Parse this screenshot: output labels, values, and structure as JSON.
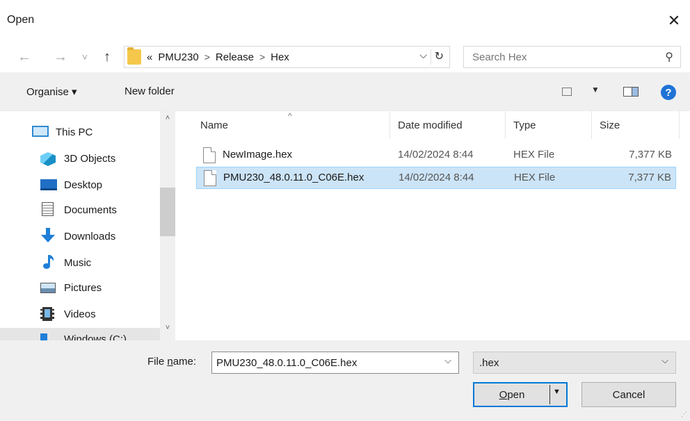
{
  "window": {
    "title": "Open",
    "close_glyph": "✕"
  },
  "nav": {
    "back_icon": "←",
    "forward_icon": "→",
    "recent_icon": "˅",
    "up_icon": "↑"
  },
  "address": {
    "overflow": "«",
    "crumbs": [
      "PMU230",
      "Release",
      "Hex"
    ],
    "separator": ">",
    "dropdown_glyph": "⌵",
    "refresh_glyph": "↻"
  },
  "search": {
    "placeholder": "Search Hex",
    "icon": "⚲"
  },
  "toolbar": {
    "organise_label": "Organise ▾",
    "new_folder_label": "New folder",
    "view_dropdown": "▼",
    "help_label": "?"
  },
  "sidebar": {
    "items": [
      {
        "label": "This PC",
        "icon": "computer-icon"
      },
      {
        "label": "3D Objects",
        "icon": "3d-objects-icon"
      },
      {
        "label": "Desktop",
        "icon": "desktop-icon"
      },
      {
        "label": "Documents",
        "icon": "documents-icon"
      },
      {
        "label": "Downloads",
        "icon": "downloads-icon"
      },
      {
        "label": "Music",
        "icon": "music-icon"
      },
      {
        "label": "Pictures",
        "icon": "pictures-icon"
      },
      {
        "label": "Videos",
        "icon": "videos-icon"
      },
      {
        "label": "Windows (C:)",
        "icon": "drive-icon"
      }
    ],
    "scroll_up": "˄",
    "scroll_down": "˅"
  },
  "files": {
    "sort_arrow": "^",
    "columns": [
      "Name",
      "Date modified",
      "Type",
      "Size"
    ],
    "rows": [
      {
        "name": "NewImage.hex",
        "date": "14/02/2024 8:44",
        "type": "HEX File",
        "size": "7,377 KB",
        "selected": false
      },
      {
        "name": "PMU230_48.0.11.0_C06E.hex",
        "date": "14/02/2024 8:44",
        "type": "HEX File",
        "size": "7,377 KB",
        "selected": true
      }
    ]
  },
  "footer": {
    "file_name_label_pre": "File ",
    "file_name_label_underlined": "n",
    "file_name_label_post": "ame:",
    "file_name_value": "PMU230_48.0.11.0_C06E.hex",
    "filter_value": ".hex",
    "open_label_underlined": "O",
    "open_label_rest": "pen",
    "open_arrow": "▼",
    "cancel_label": "Cancel",
    "chevron": "⌵"
  },
  "colors": {
    "accent": "#0078d7",
    "selection": "#cce4f7",
    "selection_border": "#99d1ff"
  }
}
